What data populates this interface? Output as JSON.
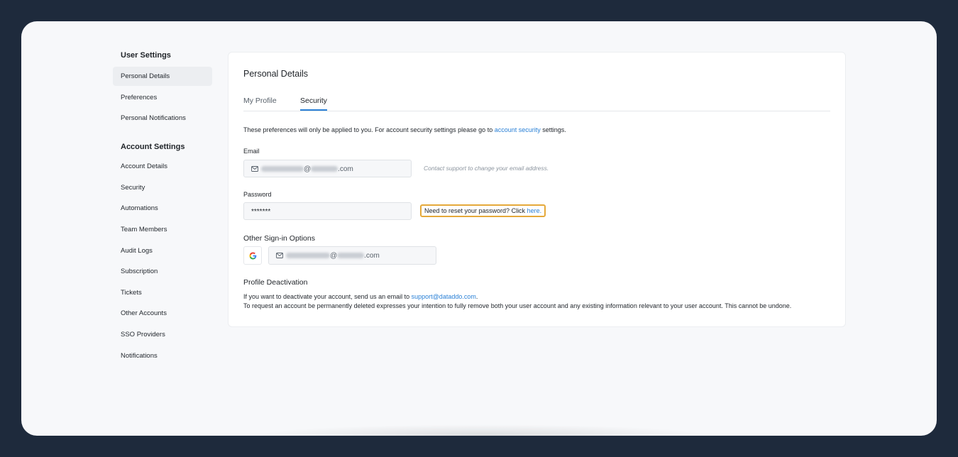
{
  "sidebar": {
    "user_heading": "User Settings",
    "user_items": [
      {
        "label": "Personal Details"
      },
      {
        "label": "Preferences"
      },
      {
        "label": "Personal Notifications"
      }
    ],
    "account_heading": "Account Settings",
    "account_items": [
      {
        "label": "Account Details"
      },
      {
        "label": "Security"
      },
      {
        "label": "Automations"
      },
      {
        "label": "Team Members"
      },
      {
        "label": "Audit Logs"
      },
      {
        "label": "Subscription"
      },
      {
        "label": "Tickets"
      },
      {
        "label": "Other Accounts"
      },
      {
        "label": "SSO Providers"
      },
      {
        "label": "Notifications"
      }
    ]
  },
  "main": {
    "title": "Personal Details",
    "tabs": [
      {
        "label": "My Profile"
      },
      {
        "label": "Security"
      }
    ],
    "intro_prefix": "These preferences will only be applied to you. For account security settings please go to",
    "intro_link": "account security",
    "intro_suffix": "settings.",
    "email_label": "Email",
    "email_at": "@",
    "email_domain_suffix": ".com",
    "email_hint": "Contact support to change your email address.",
    "password_label": "Password",
    "password_value": "*******",
    "reset_text": "Need to reset your password? Click",
    "reset_link": "here.",
    "other_signin_title": "Other Sign-in Options",
    "deactivation_title": "Profile Deactivation",
    "deactivation_line1": "If you want to deactivate your account, send us an email to",
    "deactivation_email": "support@dataddo.com",
    "deactivation_line1_end": ".",
    "deactivation_line2": "To request an account be permanently deleted expresses your intention to fully remove both your user account and any existing information relevant to your user account. This cannot be undone."
  },
  "colors": {
    "accent": "#2a80d6",
    "highlight": "#e5a93a",
    "frame": "#1e2a3c"
  },
  "icons": {
    "mail": "mail-icon",
    "google": "google-icon"
  }
}
